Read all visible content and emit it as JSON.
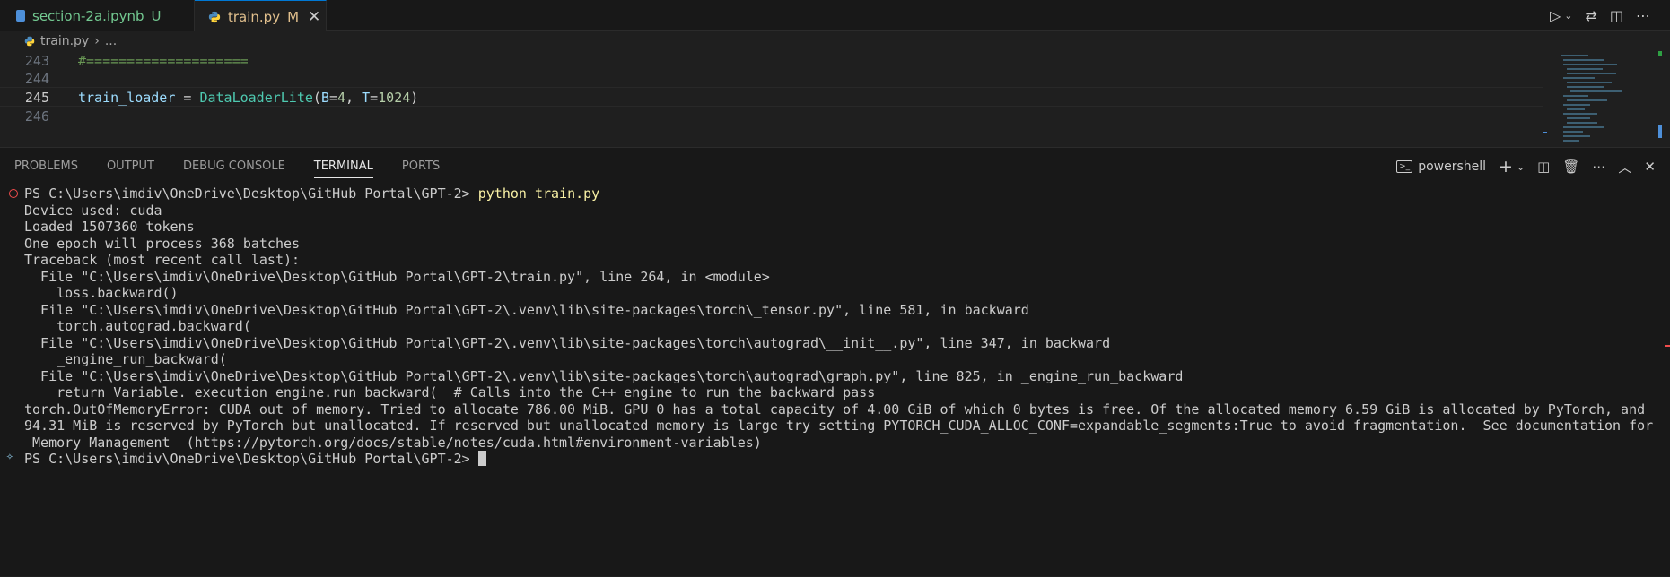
{
  "tabs": [
    {
      "name": "section-2a.ipynb",
      "badge": "U",
      "icon": "notebook-icon"
    },
    {
      "name": "train.py",
      "badge": "M",
      "icon": "python-icon",
      "close": "✕"
    }
  ],
  "breadcrumb": {
    "file": "train.py",
    "sep": "›",
    "more": "..."
  },
  "code": {
    "lines": [
      {
        "num": "243",
        "comment": "#===================="
      },
      {
        "num": "244"
      },
      {
        "num": "245",
        "var": "train_loader",
        "op": " = ",
        "cls": "DataLoaderLite",
        "args_open": "(",
        "b": "B",
        "eq1": "=",
        "bval": "4",
        "comma": ", ",
        "t": "T",
        "eq2": "=",
        "tval": "1024",
        "close": ")"
      },
      {
        "num": "246"
      }
    ]
  },
  "panel": {
    "tabs": [
      "PROBLEMS",
      "OUTPUT",
      "DEBUG CONSOLE",
      "TERMINAL",
      "PORTS"
    ],
    "active_tab": "TERMINAL",
    "shell": "powershell"
  },
  "terminal": {
    "prompt": "PS C:\\Users\\imdiv\\OneDrive\\Desktop\\GitHub Portal\\GPT-2> ",
    "command": "python train.py",
    "output": [
      "Device used: cuda",
      "Loaded 1507360 tokens",
      "One epoch will process 368 batches",
      "Traceback (most recent call last):",
      "  File \"C:\\Users\\imdiv\\OneDrive\\Desktop\\GitHub Portal\\GPT-2\\train.py\", line 264, in <module>",
      "    loss.backward()",
      "  File \"C:\\Users\\imdiv\\OneDrive\\Desktop\\GitHub Portal\\GPT-2\\.venv\\lib\\site-packages\\torch\\_tensor.py\", line 581, in backward",
      "    torch.autograd.backward(",
      "  File \"C:\\Users\\imdiv\\OneDrive\\Desktop\\GitHub Portal\\GPT-2\\.venv\\lib\\site-packages\\torch\\autograd\\__init__.py\", line 347, in backward",
      "    _engine_run_backward(",
      "  File \"C:\\Users\\imdiv\\OneDrive\\Desktop\\GitHub Portal\\GPT-2\\.venv\\lib\\site-packages\\torch\\autograd\\graph.py\", line 825, in _engine_run_backward",
      "    return Variable._execution_engine.run_backward(  # Calls into the C++ engine to run the backward pass",
      "torch.OutOfMemoryError: CUDA out of memory. Tried to allocate 786.00 MiB. GPU 0 has a total capacity of 4.00 GiB of which 0 bytes is free. Of the allocated memory 6.59 GiB is allocated by PyTorch, and",
      "94.31 MiB is reserved by PyTorch but unallocated. If reserved but unallocated memory is large try setting PYTORCH_CUDA_ALLOC_CONF=expandable_segments:True to avoid fragmentation.  See documentation for",
      " Memory Management  (https://pytorch.org/docs/stable/notes/cuda.html#environment-variables)"
    ],
    "final_prompt": "PS C:\\Users\\imdiv\\OneDrive\\Desktop\\GitHub Portal\\GPT-2> "
  },
  "colors": {
    "accent": "#0078d4",
    "error": "#f14c4c",
    "modified": "#e2c08d",
    "untracked": "#73c991"
  }
}
